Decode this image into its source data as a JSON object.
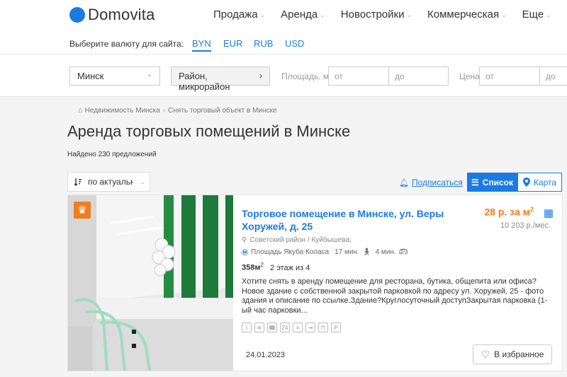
{
  "brand": {
    "name": "Domovita",
    "color": "#1b7be0",
    "icon": "logo-dot-icon"
  },
  "nav": [
    {
      "label": "Продажа",
      "icon": "chevron-down-icon"
    },
    {
      "label": "Аренда",
      "icon": "chevron-down-icon"
    },
    {
      "label": "Новостройки",
      "icon": "chevron-down-icon"
    },
    {
      "label": "Коммерческая",
      "icon": "chevron-down-icon"
    },
    {
      "label": "Еще",
      "icon": "chevron-down-icon"
    }
  ],
  "currency": {
    "label": "Выберите валюту для сайта:",
    "options": [
      "BYN",
      "EUR",
      "RUB",
      "USD"
    ],
    "selected": "BYN"
  },
  "filters": {
    "city": "Минск",
    "district": "Район, микрорайон",
    "area_label": "Площадь, м²",
    "area_from": "от",
    "area_to": "до",
    "price_label": "Цена",
    "price_from": "от",
    "price_to": "до"
  },
  "breadcrumb": [
    "Недвижимость Минска",
    "Снять торговый объект в Минске"
  ],
  "page": {
    "title": "Аренда торговых помещений в Минске",
    "found": "Найдено 230 предложений"
  },
  "toolbar": {
    "sort": "по актуальности",
    "subscribe": "Подписаться",
    "view_list": "Список",
    "view_map": "Карта"
  },
  "listing": {
    "title": "Торговое помещение в Минске, ул. Веры Хоружей, д. 25",
    "price": "28 р. за м",
    "price_unit_sup": "2",
    "price_month": "10 203 р./мес.",
    "address": "Советский район / Куйбышева;",
    "metro": "Площадь Якуба Коласа",
    "walk": "17 мин.",
    "transport": "4 мин.",
    "area": "358м",
    "area_sup": "2",
    "floor": "2 этаж из 4",
    "description": "Хотите снять в аренду помещение для ресторана, бутика, общепита или офиса? Новое здание с собственной закрытой парковкой по адресу ул. Хоружей, 25 - фото здания и описание по ссылке.Здание?Круглосуточный доступЗакрытая парковка (1-ый час парковки...",
    "date": "24.01.2023",
    "favorite": "В избранное",
    "amenities": [
      "water-icon",
      "heating-icon",
      "phone-icon",
      "24h-icon",
      "document-icon",
      "entrance-icon",
      "furniture-icon",
      "parking-icon"
    ],
    "badge_color": "#f07d1e"
  }
}
